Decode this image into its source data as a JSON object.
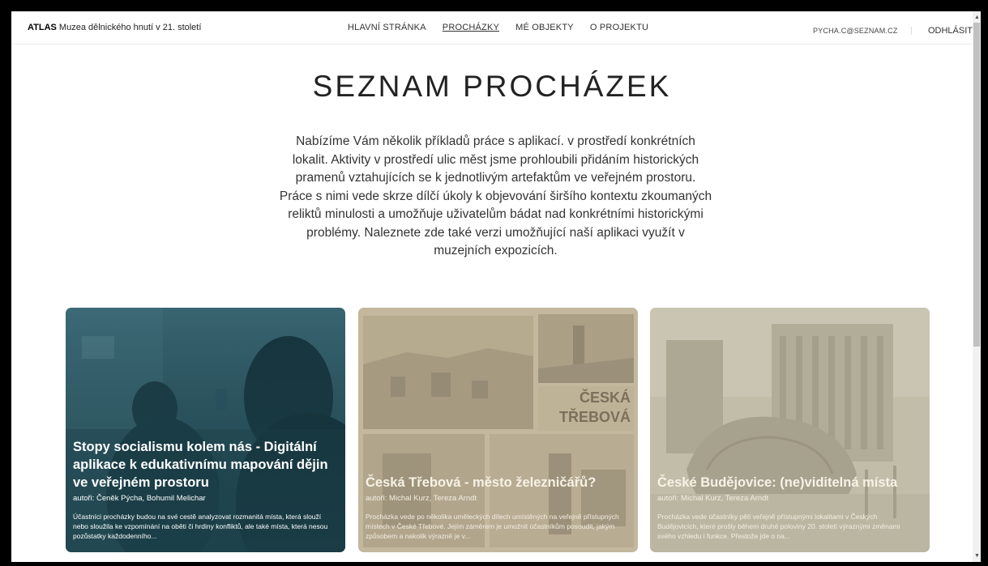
{
  "navbar": {
    "brand_strong": "ATLAS",
    "brand_rest": " Muzea dělnického hnutí v 21. století",
    "links": [
      {
        "label": "HLAVNÍ STRÁNKA"
      },
      {
        "label": "PROCHÁZKY"
      },
      {
        "label": "MÉ OBJEKTY"
      },
      {
        "label": "O PROJEKTU"
      }
    ],
    "email": "PYCHA.C@SEZNAM.CZ",
    "logout": "ODHLÁSIT"
  },
  "page": {
    "title": "SEZNAM PROCHÁZEK",
    "intro": "Nabízíme Vám několik příkladů práce s aplikací. v prostředí konkrétních lokalit. Aktivity v prostředí ulic měst jsme prohloubili přidáním historických pramenů vztahujících se k jednotlivým artefaktům ve veřejném prostoru. Práce s nimi vede skrze dílčí úkoly k objevování širšího kontextu zkoumaných reliktů minulosti a umožňuje uživatelům bádat nad konkrétními historickými problémy. Naleznete zde také verzi umožňující naší aplikaci využít v muzejních expozicích."
  },
  "cards": [
    {
      "title": "Stopy socialismu kolem nás - Digitální aplikace k edukativnímu mapování dějin ve veřejném prostoru",
      "authors": "autoři: Čeněk Pýcha, Bohumil Melichar",
      "description": "Účastníci procházky budou na své cestě analyzovat rozmanitá místa, která slouží nebo sloužila ke vzpomínání na oběti či hrdiny konfliktů, ale také místa, která nesou pozůstatky každodenního...",
      "image_text": ""
    },
    {
      "title": "Česká Třebová - město železničářů?",
      "authors": "autoři: Michal Kurz, Tereza Arndt",
      "description": "Procházka vede po několika uměleckých dílech umístěných na veřejně přístupných místech v České Třebové. Jejím záměrem je umožnit účastníkům posoudit, jakým způsobem a nakolik výrazně je v...",
      "image_text_1": "ČESKÁ",
      "image_text_2": "TŘEBOVÁ"
    },
    {
      "title": "České Budějovice: (ne)viditelná místa",
      "authors": "autoři: Michal Kurz, Tereza Arndt",
      "description": "Procházka vede účastníky pěti veřejně přístupnými lokalitami v Českých Budějovicích, které prošly během druhé poloviny 20. století výraznými změnami svého vzhledu i funkce. Přestože jde o na..."
    }
  ],
  "colors": {
    "card1_overlay": "#1e4650",
    "card2_overlay": "#b8ac90",
    "card3_overlay": "#b7b29e"
  }
}
